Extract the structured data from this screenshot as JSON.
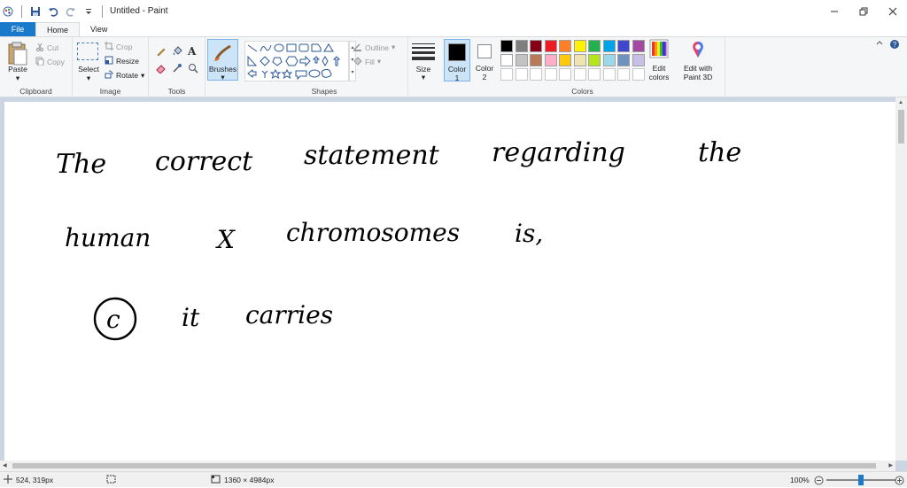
{
  "window": {
    "title": "Untitled - Paint"
  },
  "tabs": [
    {
      "label": "File"
    },
    {
      "label": "Home"
    },
    {
      "label": "View"
    }
  ],
  "clipboard": {
    "paste": "Paste",
    "cut": "Cut",
    "copy": "Copy",
    "group": "Clipboard"
  },
  "image": {
    "select": "Select",
    "crop": "Crop",
    "resize": "Resize",
    "rotate": "Rotate",
    "group": "Image"
  },
  "tools": {
    "group": "Tools"
  },
  "brushes": {
    "label": "Brushes"
  },
  "shapes": {
    "outline": "Outline",
    "fill": "Fill",
    "group": "Shapes"
  },
  "size": {
    "label": "Size"
  },
  "colors": {
    "color1_label": "Color",
    "color1_num": "1",
    "color2_label": "Color",
    "color2_num": "2",
    "edit_colors_1": "Edit",
    "edit_colors_2": "colors",
    "paint3d_1": "Edit with",
    "paint3d_2": "Paint 3D",
    "group": "Colors",
    "color1": "#000000",
    "color2": "#ffffff",
    "palette_row1": [
      "#000000",
      "#7f7f7f",
      "#880015",
      "#ed1c24",
      "#ff7f27",
      "#fff200",
      "#22b14c",
      "#00a2e8",
      "#3f48cc",
      "#a349a4"
    ],
    "palette_row2": [
      "#ffffff",
      "#c3c3c3",
      "#b97a57",
      "#ffaec9",
      "#ffc90e",
      "#efe4b0",
      "#b5e61d",
      "#99d9ea",
      "#7092be",
      "#c8bfe7"
    ]
  },
  "canvas": {
    "line1": [
      "The",
      "correct",
      "statement",
      "regarding",
      "the"
    ],
    "line2": [
      "human",
      "X",
      "chromosomes",
      "is,"
    ],
    "line3_option": "c",
    "line3": [
      "it",
      "carries"
    ]
  },
  "status": {
    "cursor_pos": "524, 319px",
    "image_size": "1360 × 4984px",
    "zoom": "100%",
    "zoom_level": 1.0
  }
}
